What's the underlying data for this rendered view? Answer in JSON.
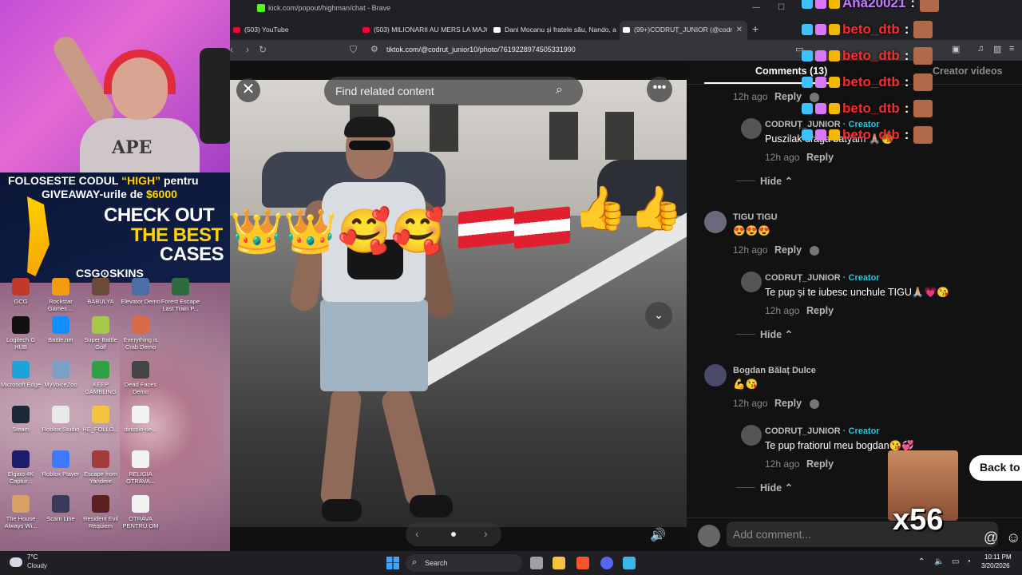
{
  "browser": {
    "window_title": "kick.com/popout/highman/chat - Brave",
    "tabs": [
      {
        "label": "(503) YouTube",
        "favicon_color": "#ff0033"
      },
      {
        "label": "(503) MILIONARII AU MERS LA MAJO",
        "favicon_color": "#ff0033"
      },
      {
        "label": "Dani Mocanu și fratele său, Nando, a",
        "favicon_color": "#ffffff"
      },
      {
        "label": "(99+)CODRUȚ_JUNIOR (@codr",
        "favicon_color": "#ffffff"
      }
    ],
    "new_tab_symbol": "+",
    "url": "tiktok.com/@codrut_junior10/photo/7619228974505331990"
  },
  "viewer": {
    "search_placeholder": "Find related content",
    "close_symbol": "✕",
    "more_symbol": "•••",
    "down_symbol": "⌄",
    "prev_symbol": "‹",
    "next_symbol": "›",
    "volume_symbol": "🔊"
  },
  "comments_panel": {
    "tabs": [
      "Comments (13)",
      "Creator videos"
    ],
    "items": [
      {
        "kind": "meta",
        "time": "12h ago",
        "reply": "Reply"
      },
      {
        "kind": "reply",
        "user": "CODRUȚ_JUNIOR",
        "creator_tag": " · Creator",
        "text": "Puszilak draga batyam 🙏🏼😘",
        "time": "12h ago",
        "reply": "Reply",
        "hide": "Hide"
      },
      {
        "kind": "comment",
        "user": "TIGU TIGU",
        "text": "😍😍😍",
        "time": "12h ago",
        "reply": "Reply"
      },
      {
        "kind": "reply",
        "user": "CODRUȚ_JUNIOR",
        "creator_tag": " · Creator",
        "text": "Te pup și te iubesc unchule TIGU🙏🏼💗😘",
        "time": "12h ago",
        "reply": "Reply",
        "hide": "Hide"
      },
      {
        "kind": "comment",
        "user": "Bogdan Bălaț Dulce",
        "text": "💪😘",
        "time": "12h ago",
        "reply": "Reply"
      },
      {
        "kind": "reply",
        "user": "CODRUȚ_JUNIOR",
        "creator_tag": " · Creator",
        "text": "Te pup fratiorul meu bogdan😘💞",
        "time": "12h ago",
        "reply": "Reply",
        "hide": "Hide"
      }
    ],
    "add_comment_placeholder": "Add comment...",
    "at_symbol": "@",
    "emoji_symbol": "☺"
  },
  "stream_overlay": {
    "promo": {
      "line1_a": "FOLOSESTE CODUL ",
      "line1_code": "“HIGH”",
      "line1_b": " pentru",
      "line2_a": "GIVEAWAY-urile de ",
      "line2_amount": "$6000",
      "cta1": "CHECK OUT",
      "cta2": "THE BEST",
      "cta3": "CASES",
      "brand": "CSG⊙SKINS"
    },
    "webcam_shirt_text": "APE",
    "chat": [
      {
        "user": "Ana20021",
        "color": "#c07cff"
      },
      {
        "user": "beto_dtb",
        "color": "#ff2a2a"
      },
      {
        "user": "beto_dtb",
        "color": "#ff2a2a"
      },
      {
        "user": "beto_dtb",
        "color": "#ff2a2a"
      },
      {
        "user": "beto_dtb",
        "color": "#ff2a2a"
      },
      {
        "user": "beto_dtb",
        "color": "#ff2a2a"
      }
    ],
    "chat_colon": ":",
    "meme_multiplier": "x56",
    "back_to_label": "Back to"
  },
  "desktop_icons": [
    {
      "label": "GCG",
      "color": "#c0392b"
    },
    {
      "label": "Rockstar Games ...",
      "color": "#f39c12"
    },
    {
      "label": "BABULYA",
      "color": "#6c4a3a"
    },
    {
      "label": "Elevator Demo",
      "color": "#4a6fa5"
    },
    {
      "label": "Forest Escape Last Train P...",
      "color": "#2e6b3f"
    },
    {
      "label": "Logitech G HUB",
      "color": "#111111"
    },
    {
      "label": "Battle.net",
      "color": "#148eff"
    },
    {
      "label": "Super Battle Golf",
      "color": "#a8c64a"
    },
    {
      "label": "Everything is Crab Demo",
      "color": "#d96b4a"
    },
    {
      "label": "Microsoft Edge",
      "color": "#1fa3d6"
    },
    {
      "label": "MyVoiceZoo",
      "color": "#7aa0c8"
    },
    {
      "label": "KEEP GAMBLING",
      "color": "#2ea043"
    },
    {
      "label": "Dead Faces Demo",
      "color": "#444444"
    },
    {
      "label": "Steam",
      "color": "#1b2838"
    },
    {
      "label": "Roblox Studio",
      "color": "#e9e9e9"
    },
    {
      "label": "HE_FOLLO...",
      "color": "#f5c242"
    },
    {
      "label": "dincolo-de...",
      "color": "#f2f2f2"
    },
    {
      "label": "Elgato 4K Captur...",
      "color": "#1d1d6b"
    },
    {
      "label": "Roblox Player",
      "color": "#3c7bff"
    },
    {
      "label": "Escape from Yandere",
      "color": "#a33b3b"
    },
    {
      "label": "RELIGIA OTRAVA...",
      "color": "#f2f2f2"
    },
    {
      "label": "The House Always Wi...",
      "color": "#d9a066"
    },
    {
      "label": "Scam Line",
      "color": "#3a3a5a"
    },
    {
      "label": "Resident Evil Requiem",
      "color": "#5a2020"
    },
    {
      "label": "OTRAVA PENTRU OM",
      "color": "#f2f2f2"
    }
  ],
  "taskbar": {
    "weather_temp": "7°C",
    "weather_desc": "Cloudy",
    "search_label": "Search",
    "time": "10:11 PM",
    "date": "3/20/2026"
  }
}
